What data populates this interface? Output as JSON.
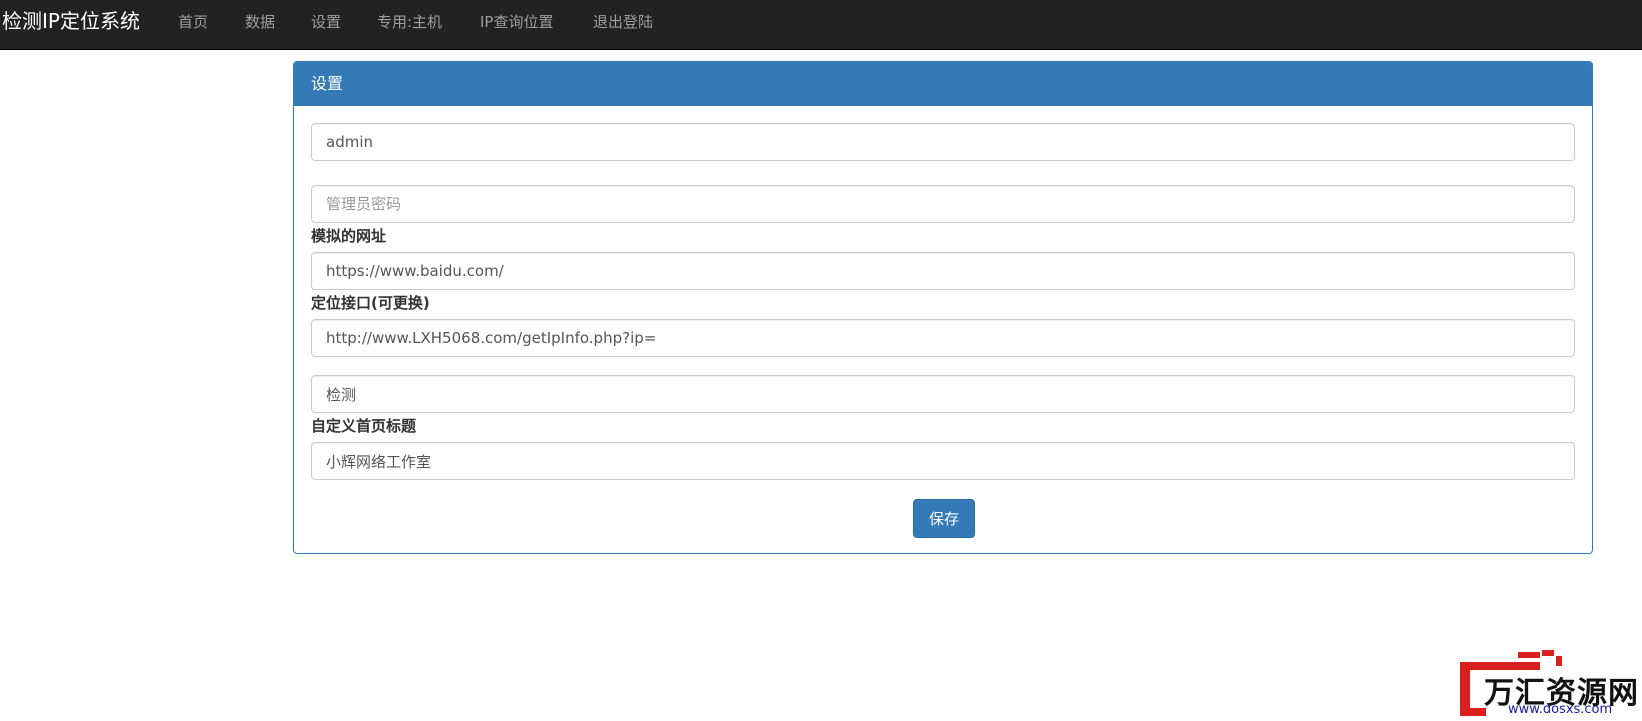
{
  "navbar": {
    "brand": "检测IP定位系统",
    "items": [
      {
        "label": "首页"
      },
      {
        "label": "数据"
      },
      {
        "label": "设置"
      },
      {
        "label": "专用:主机"
      },
      {
        "label": "IP查询位置"
      },
      {
        "label": "退出登陆"
      }
    ]
  },
  "panel": {
    "title": "设置",
    "username": {
      "value": "admin"
    },
    "password": {
      "placeholder": "管理员密码",
      "value": ""
    },
    "mock_url": {
      "label": "模拟的网址",
      "value": "https://www.baidu.com/"
    },
    "locate_api": {
      "label": "定位接口(可更换)",
      "value": "http://www.LXH5068.com/getIpInfo.php?ip="
    },
    "detect": {
      "value": "检测"
    },
    "home_title": {
      "label": "自定义首页标题",
      "value": "小辉网络工作室"
    },
    "save_label": "保存"
  },
  "watermark": {
    "text": "万汇资源网",
    "url": "www.dosxs.com"
  },
  "colors": {
    "navbar_bg": "#222222",
    "nav_text": "#9d9d9d",
    "primary": "#337ab7",
    "watermark_red": "#d9201f"
  }
}
